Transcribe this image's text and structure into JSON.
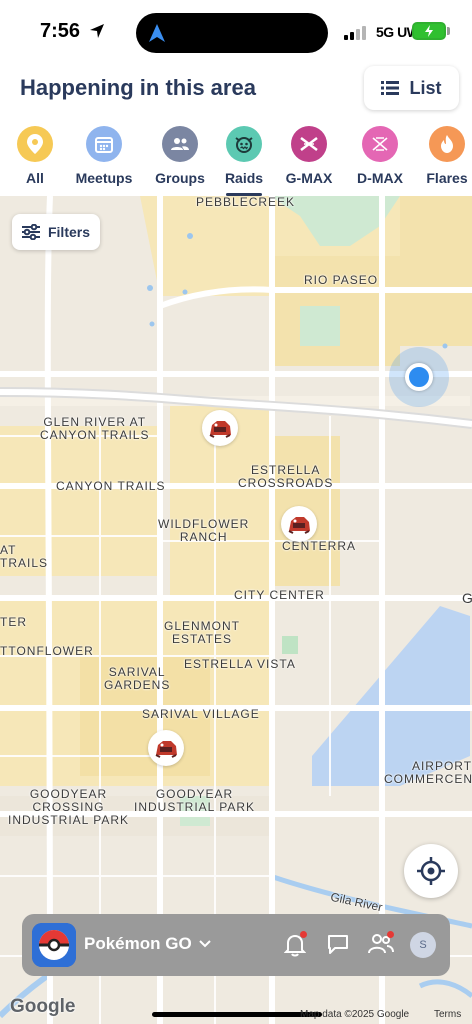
{
  "status_bar": {
    "time": "7:56",
    "network": "5G UW"
  },
  "header": {
    "title": "Happening in this area",
    "list_button_label": "List"
  },
  "categories": [
    {
      "label": "All",
      "color": "#f6c955",
      "icon": "pin-icon"
    },
    {
      "label": "Meetups",
      "color": "#8fb4ee",
      "icon": "calendar-icon"
    },
    {
      "label": "Groups",
      "color": "#7b86a2",
      "icon": "people-icon"
    },
    {
      "label": "Raids",
      "color": "#5cc9b2",
      "icon": "raid-face-icon",
      "selected": true
    },
    {
      "label": "G-MAX",
      "color": "#c0408a",
      "icon": "gmax-icon"
    },
    {
      "label": "D-MAX",
      "color": "#e467b4",
      "icon": "dmax-icon"
    },
    {
      "label": "Flares",
      "color": "#f59856",
      "icon": "flame-icon"
    }
  ],
  "map": {
    "filters_label": "Filters",
    "labels": {
      "pebblecreek": "PEBBLECREEK",
      "rio_paseo": "RIO PASEO",
      "glen_river": "GLEN RIVER AT\nCANYON TRAILS",
      "estrella_crossroads": "ESTRELLA\nCROSSROADS",
      "canyon_trails": "CANYON TRAILS",
      "wildflower_ranch": "WILDFLOWER\nRANCH",
      "centerra": "CENTERRA",
      "at_trails": "AT\nTRAILS",
      "city_center": "CITY CENTER",
      "glenmont_estates": "GLENMONT\nESTATES",
      "ter": "TER",
      "ttonflower": "TTONFLOWER",
      "estrella_vista": "ESTRELLA VISTA",
      "sarival_gardens": "SARIVAL\nGARDENS",
      "sarival_village": "SARIVAL VILLAGE",
      "airport_commercenter": "AIRPORT\nCOMMERCENTER",
      "goodyear_crossing": "GOODYEAR\nCROSSING\nINDUSTRIAL PARK",
      "goodyear_industrial": "GOODYEAR\nINDUSTRIAL PARK",
      "gila_river": "Gila River",
      "g_edge": "G"
    },
    "google": "Google",
    "map_data": "Map data ©2025 Google",
    "terms": "Terms"
  },
  "bottom_bar": {
    "app_name": "Pokémon GO",
    "avatar_initial": "S"
  }
}
